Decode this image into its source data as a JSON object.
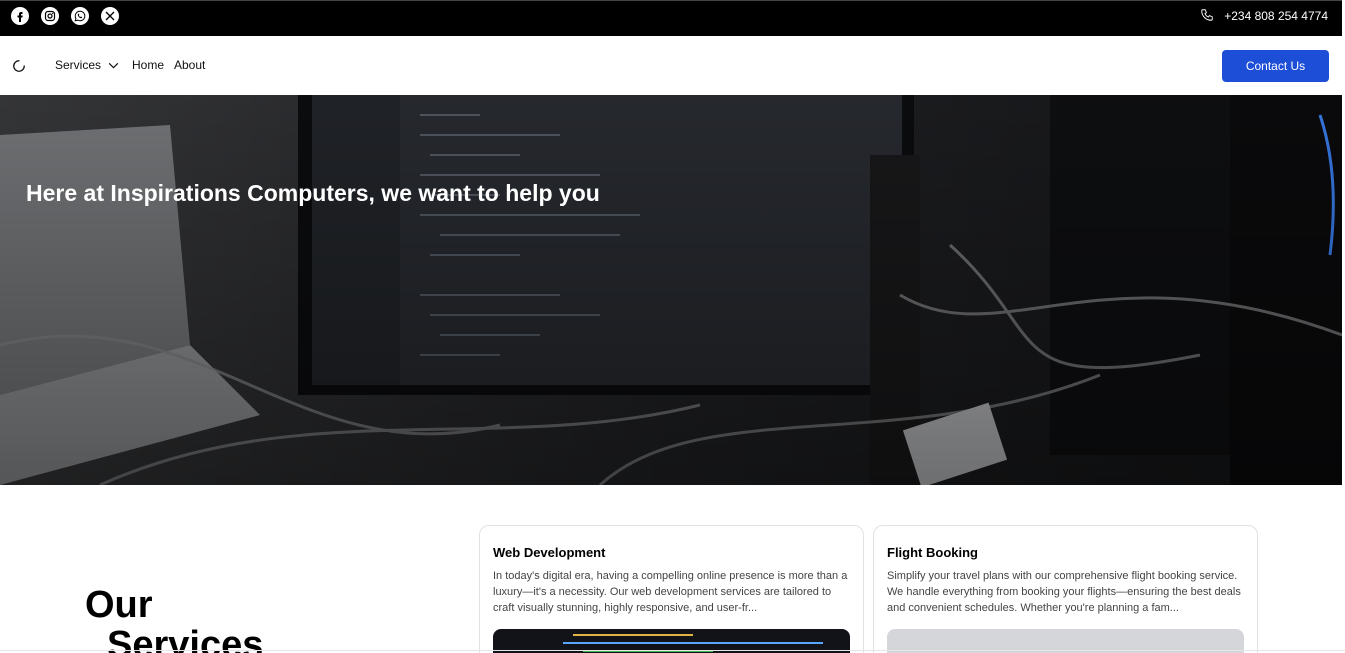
{
  "topbar": {
    "social": [
      {
        "name": "facebook-icon"
      },
      {
        "name": "instagram-icon"
      },
      {
        "name": "whatsapp-icon"
      },
      {
        "name": "x-icon"
      }
    ],
    "phone": "+234 808 254 4774"
  },
  "nav": {
    "services_label": "Services",
    "home_label": "Home",
    "about_label": "About",
    "contact_label": "Contact Us"
  },
  "hero": {
    "title": "Here at Inspirations Computers, we want to help you"
  },
  "services": {
    "heading_line1": "Our",
    "heading_line2": "Services",
    "cards": [
      {
        "title": "Web Development",
        "text": "In today's digital era, having a compelling online presence is more than a luxury—it's a necessity. Our web development services are tailored to craft visually stunning, highly responsive, and user-fr..."
      },
      {
        "title": "Flight Booking",
        "text": "Simplify your travel plans with our comprehensive flight booking service. We handle everything from booking your flights—ensuring the best deals and convenient schedules. Whether you're planning a fam..."
      }
    ]
  },
  "colors": {
    "primary": "#1d4ed8",
    "topbar": "#000000"
  }
}
